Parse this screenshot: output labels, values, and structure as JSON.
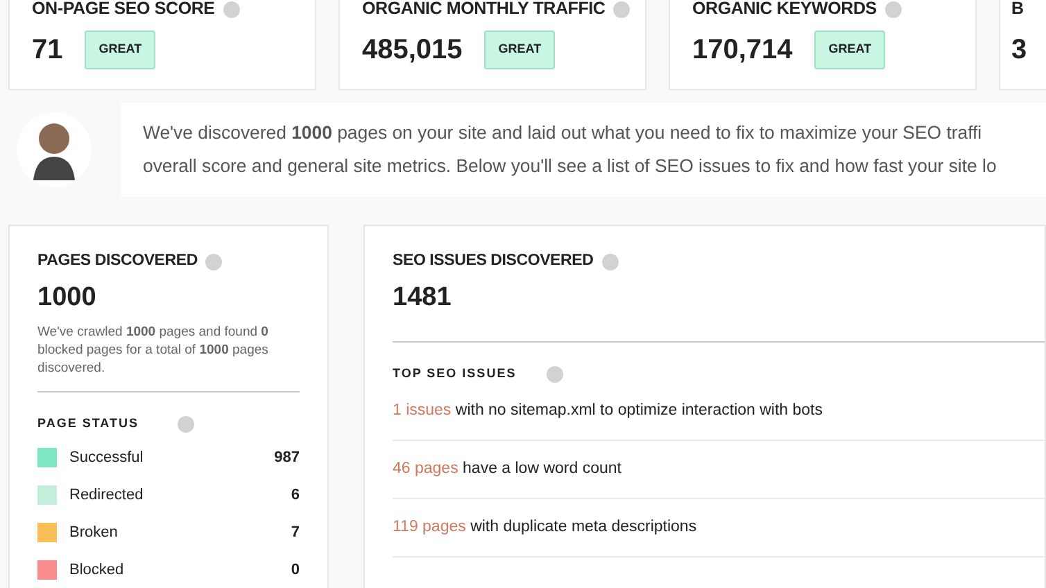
{
  "metrics": [
    {
      "title": "ON-PAGE SEO SCORE",
      "value": "71",
      "badge": "GREAT"
    },
    {
      "title": "ORGANIC MONTHLY TRAFFIC",
      "value": "485,015",
      "badge": "GREAT"
    },
    {
      "title": "ORGANIC KEYWORDS",
      "value": "170,714",
      "badge": "GREAT"
    },
    {
      "title": "B",
      "value": "3"
    }
  ],
  "intro": {
    "lines": [
      "We've discovered **1000** pages on your site and laid out what you need to fix to maximize your SEO traffi",
      "overall score and general site metrics. Below you'll see a list of SEO issues to fix and how fast your site lo"
    ]
  },
  "pages_discovered": {
    "title": "PAGES DISCOVERED",
    "value": "1000",
    "description": "We've crawled **1000** pages and found **0** blocked pages for a total of **1000** pages discovered.",
    "status_title": "PAGE STATUS",
    "statuses": [
      {
        "label": "Successful",
        "count": "987",
        "color": "#7ee6c0"
      },
      {
        "label": "Redirected",
        "count": "6",
        "color": "#c3eedc"
      },
      {
        "label": "Broken",
        "count": "7",
        "color": "#f8bf58"
      },
      {
        "label": "Blocked",
        "count": "0",
        "color": "#f98a8d"
      }
    ]
  },
  "seo_issues": {
    "title": "SEO ISSUES DISCOVERED",
    "value": "1481",
    "top_title": "TOP SEO ISSUES",
    "issues": [
      {
        "count": "1 issues",
        "text": "with no sitemap.xml to optimize interaction with bots"
      },
      {
        "count": "46 pages",
        "text": "have a low word count"
      },
      {
        "count": "119 pages",
        "text": "with duplicate meta descriptions"
      }
    ]
  }
}
